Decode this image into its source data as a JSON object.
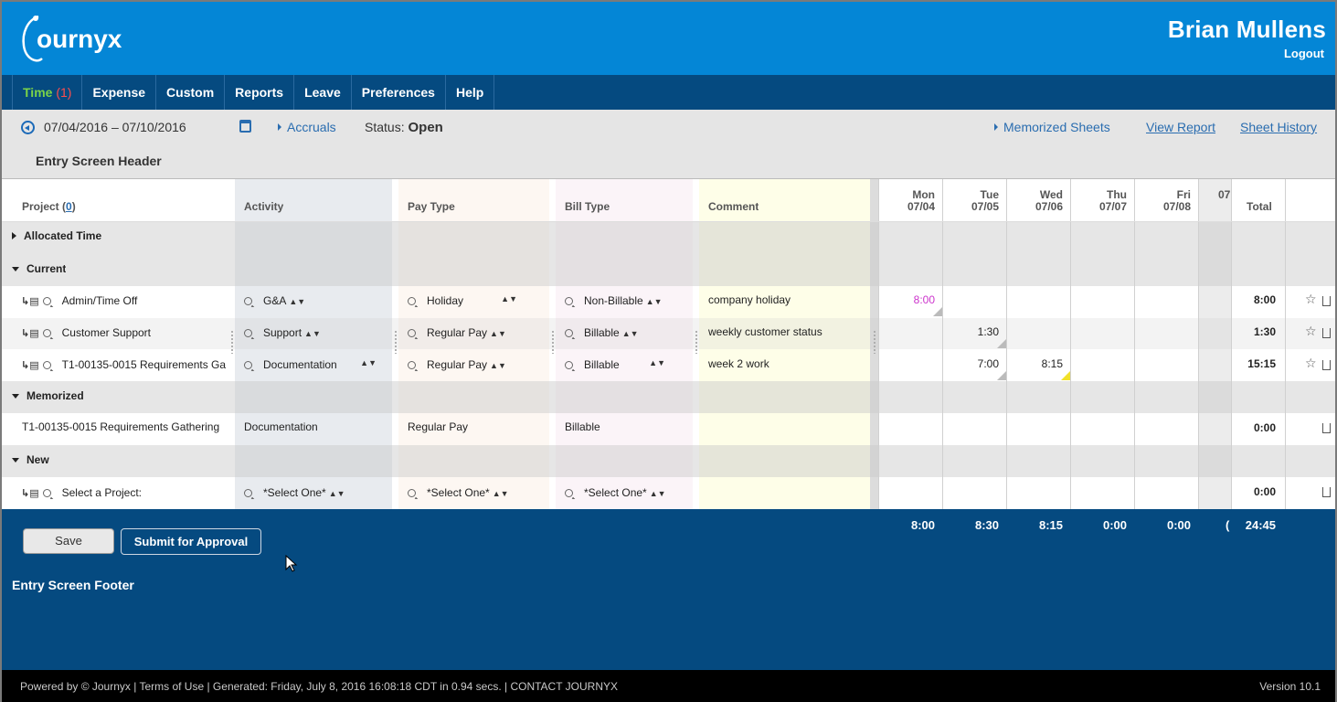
{
  "app": {
    "logo_text": "journyx"
  },
  "user": {
    "name": "Brian Mullens",
    "logout": "Logout"
  },
  "nav": {
    "time_label": "Time",
    "time_badge": "(1)",
    "items": [
      "Expense",
      "Custom",
      "Reports",
      "Leave",
      "Preferences",
      "Help"
    ]
  },
  "toolbar": {
    "date_range": "07/04/2016 – 07/10/2016",
    "accruals": "Accruals",
    "status_label": "Status:",
    "status_value": "Open",
    "memorized_sheets": "Memorized Sheets",
    "view_report": "View Report",
    "sheet_history": "Sheet History",
    "header_title": "Entry Screen Header"
  },
  "columns": {
    "project": "Project (",
    "project_count": "0",
    "project_close": ")",
    "activity": "Activity",
    "pay_type": "Pay Type",
    "bill_type": "Bill Type",
    "comment": "Comment",
    "total": "Total",
    "days": [
      {
        "dow": "Mon",
        "date": "07/04"
      },
      {
        "dow": "Tue",
        "date": "07/05"
      },
      {
        "dow": "Wed",
        "date": "07/06"
      },
      {
        "dow": "Thu",
        "date": "07/07"
      },
      {
        "dow": "Fri",
        "date": "07/08"
      },
      {
        "dow": "",
        "date": "07"
      }
    ]
  },
  "sections": {
    "allocated": "Allocated Time",
    "current": "Current",
    "memorized": "Memorized",
    "new": "New"
  },
  "rows": {
    "current": [
      {
        "project": "Admin/Time Off",
        "activity": "G&A",
        "pay": "Holiday",
        "bill": "Non-Billable",
        "comment": "company holiday",
        "mon": "8:00",
        "tue": "",
        "wed": "",
        "total": "8:00"
      },
      {
        "project": "Customer Support",
        "activity": "Support",
        "pay": "Regular Pay",
        "bill": "Billable",
        "comment": "weekly customer status",
        "mon": "",
        "tue": "1:30",
        "wed": "",
        "total": "1:30"
      },
      {
        "project": "T1-00135-0015 Requirements Ga",
        "activity": "Documentation",
        "pay": "Regular Pay",
        "bill": "Billable",
        "comment": "week 2 work",
        "mon": "",
        "tue": "7:00",
        "wed": "8:15",
        "total": "15:15"
      }
    ],
    "memorized": [
      {
        "project": "T1-00135-0015 Requirements Gathering",
        "activity": "Documentation",
        "pay": "Regular Pay",
        "bill": "Billable",
        "total": "0:00"
      }
    ],
    "new": [
      {
        "project": "Select a Project:",
        "activity": "*Select One*",
        "pay": "*Select One*",
        "bill": "*Select One*",
        "total": "0:00"
      }
    ]
  },
  "totals": {
    "mon": "8:00",
    "tue": "8:30",
    "wed": "8:15",
    "thu": "0:00",
    "fri": "0:00",
    "sat": "(",
    "grand": "24:45"
  },
  "buttons": {
    "save": "Save",
    "submit": "Submit for Approval"
  },
  "footer_title": "Entry Screen Footer",
  "statusbar": {
    "left": "Powered by © Journyx | Terms of Use | Generated: Friday, July 8, 2016 16:08:18 CDT in 0.94 secs. | CONTACT JOURNYX",
    "right": "Version 10.1"
  },
  "colors": {
    "header_blue": "#0486d6",
    "nav_blue": "#054a80",
    "active_nav": "#7bd348",
    "badge_red": "#ff4d4d",
    "link": "#2a6db0",
    "holiday_hours": "#cc33cc"
  }
}
